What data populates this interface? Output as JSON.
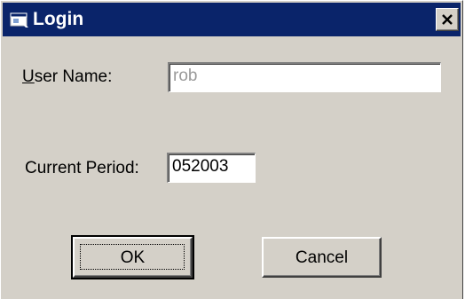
{
  "window": {
    "title": "Login",
    "close_glyph": "×",
    "icon": "app-window-icon"
  },
  "form": {
    "user_name_label_accel": "U",
    "user_name_label_rest": "ser Name:",
    "user_name_value": "rob",
    "current_period_label": "Current Period:",
    "current_period_value": "052003"
  },
  "buttons": {
    "ok_label": "OK",
    "cancel_label": "Cancel"
  },
  "colors": {
    "titlebar": "#0a246a",
    "dialog_face": "#d4d0c8",
    "disabled_text": "#9a9a9a"
  }
}
